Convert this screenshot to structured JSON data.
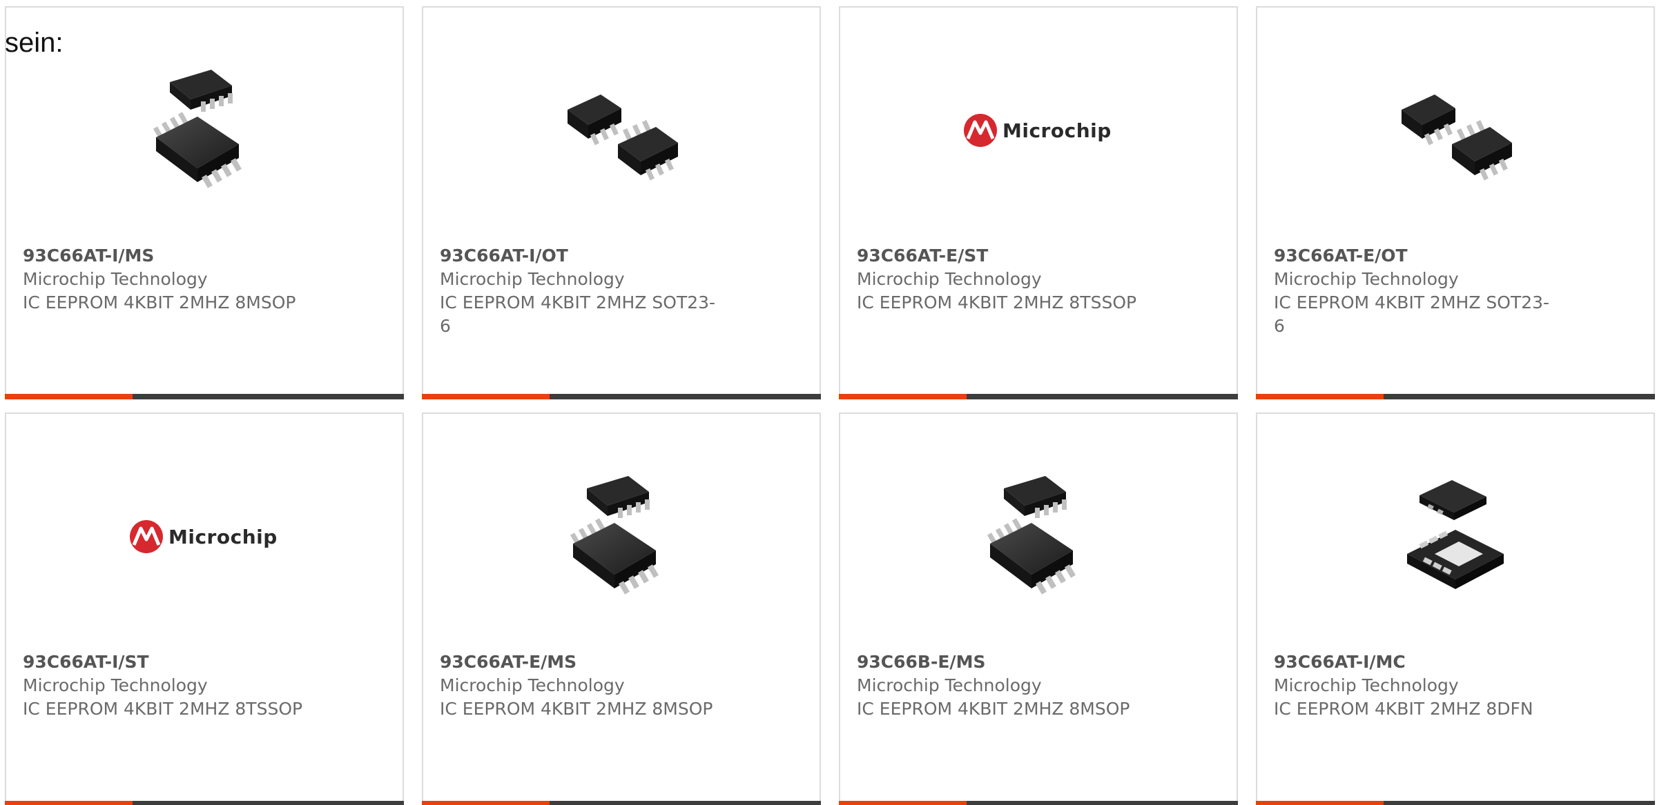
{
  "intro_text": "sein:",
  "colors": {
    "accent_bar": "#e8410f",
    "dark_bar": "#3d3d3d",
    "logo_red": "#d6282e"
  },
  "products": [
    {
      "part": "93C66AT-I/MS",
      "manufacturer": "Microchip Technology",
      "description": "IC EEPROM 4KBIT 2MHZ 8MSOP",
      "image": "msop-8-chip-icon"
    },
    {
      "part": "93C66AT-I/OT",
      "manufacturer": "Microchip Technology",
      "description": "IC EEPROM 4KBIT 2MHZ SOT23-6",
      "image": "sot23-6-chip-icon"
    },
    {
      "part": "93C66AT-E/ST",
      "manufacturer": "Microchip Technology",
      "description": "IC EEPROM 4KBIT 2MHZ 8TSSOP",
      "image": "microchip-logo",
      "logo_text": "Microchip"
    },
    {
      "part": "93C66AT-E/OT",
      "manufacturer": "Microchip Technology",
      "description": "IC EEPROM 4KBIT 2MHZ SOT23-6",
      "image": "sot23-6-chip-icon"
    },
    {
      "part": "93C66AT-I/ST",
      "manufacturer": "Microchip Technology",
      "description": "IC EEPROM 4KBIT 2MHZ 8TSSOP",
      "image": "microchip-logo",
      "logo_text": "Microchip"
    },
    {
      "part": "93C66AT-E/MS",
      "manufacturer": "Microchip Technology",
      "description": "IC EEPROM 4KBIT 2MHZ 8MSOP",
      "image": "msop-8-chip-icon"
    },
    {
      "part": "93C66B-E/MS",
      "manufacturer": "Microchip Technology",
      "description": "IC EEPROM 4KBIT 2MHZ 8MSOP",
      "image": "msop-8-chip-icon"
    },
    {
      "part": "93C66AT-I/MC",
      "manufacturer": "Microchip Technology",
      "description": "IC EEPROM 4KBIT 2MHZ 8DFN",
      "image": "dfn-8-chip-icon"
    }
  ]
}
